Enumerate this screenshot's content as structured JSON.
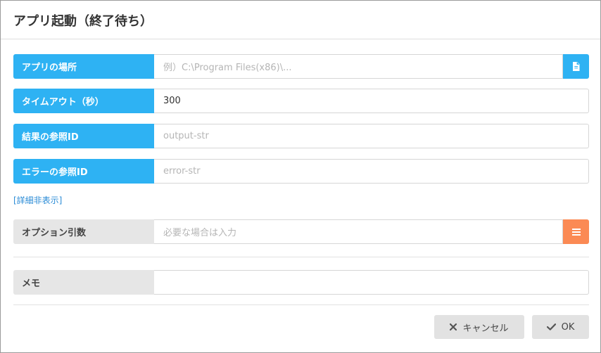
{
  "dialog": {
    "title": "アプリ起動（終了待ち）"
  },
  "fields": {
    "app_location": {
      "label": "アプリの場所",
      "value": "",
      "placeholder": "例）C:\\Program Files(x86)\\..."
    },
    "timeout": {
      "label": "タイムアウト（秒）",
      "value": "300"
    },
    "result_ref": {
      "label": "結果の参照ID",
      "value": "",
      "placeholder": "output-str"
    },
    "error_ref": {
      "label": "エラーの参照ID",
      "value": "",
      "placeholder": "error-str"
    },
    "options": {
      "label": "オプション引数",
      "value": "",
      "placeholder": "必要な場合は入力"
    },
    "memo": {
      "label": "メモ",
      "value": ""
    }
  },
  "toggle_details": "[詳細非表示]",
  "buttons": {
    "cancel": "キャンセル",
    "ok": "OK"
  },
  "colors": {
    "label_blue": "#2eb2f3",
    "options_button": "#fb8a54",
    "link": "#2a8bd6"
  },
  "icons": {
    "file_picker": "file-icon",
    "options_menu": "menu-lines-icon",
    "cancel": "close-x-icon",
    "ok": "checkmark-icon"
  }
}
